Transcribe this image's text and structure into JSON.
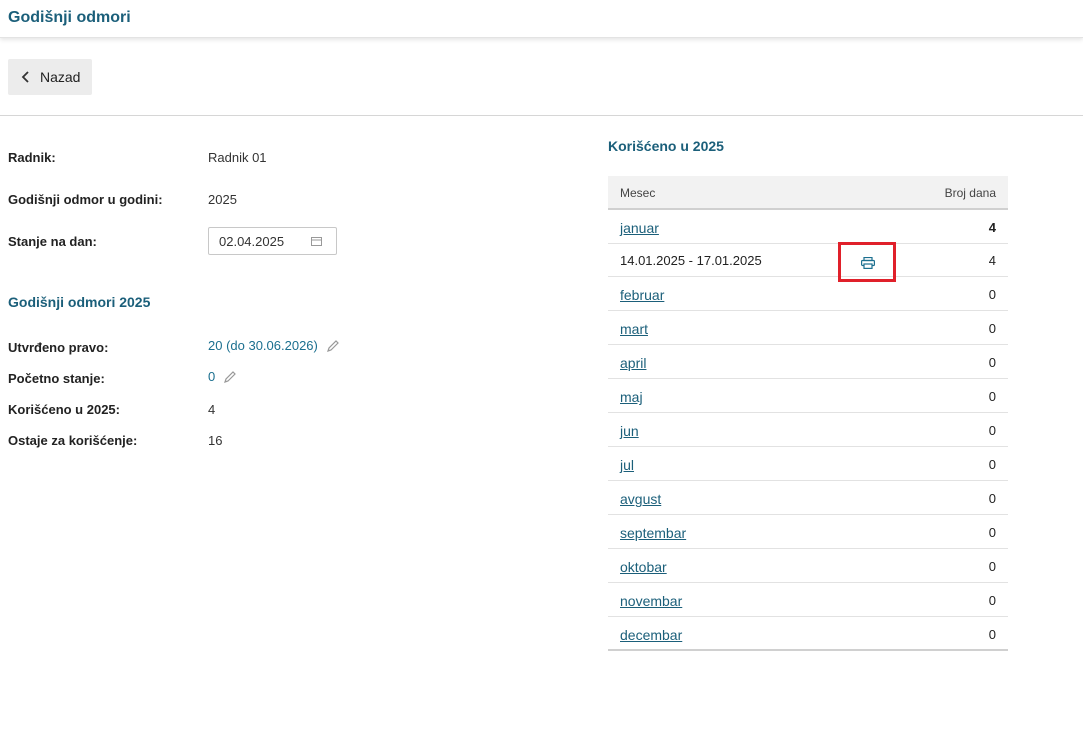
{
  "header": {
    "title": "Godišnji odmori"
  },
  "toolbar": {
    "back_label": "Nazad"
  },
  "form": {
    "employee_label": "Radnik:",
    "employee_value": "Radnik 01",
    "year_label": "Godišnji odmor u godini:",
    "year_value": "2025",
    "date_label": "Stanje na dan:",
    "date_value": "02.04.2025"
  },
  "summary": {
    "title": "Godišnji odmori 2025",
    "entitlement_label": "Utvrđeno pravo:",
    "entitlement_value": "20 (do 30.06.2026)",
    "initial_label": "Početno stanje:",
    "initial_value": "0",
    "used_label": "Korišćeno u 2025:",
    "used_value": "4",
    "remaining_label": "Ostaje za korišćenje:",
    "remaining_value": "16"
  },
  "used_table": {
    "title": "Korišćeno u 2025",
    "col_month": "Mesec",
    "col_days": "Broj dana",
    "rows": [
      {
        "month": "januar",
        "days": "4"
      },
      {
        "month": "februar",
        "days": "0"
      },
      {
        "month": "mart",
        "days": "0"
      },
      {
        "month": "april",
        "days": "0"
      },
      {
        "month": "maj",
        "days": "0"
      },
      {
        "month": "jun",
        "days": "0"
      },
      {
        "month": "jul",
        "days": "0"
      },
      {
        "month": "avgust",
        "days": "0"
      },
      {
        "month": "septembar",
        "days": "0"
      },
      {
        "month": "oktobar",
        "days": "0"
      },
      {
        "month": "novembar",
        "days": "0"
      },
      {
        "month": "decembar",
        "days": "0"
      }
    ],
    "january_period": {
      "range": "14.01.2025 - 17.01.2025",
      "days": "4"
    }
  },
  "colors": {
    "accent": "#1b5f7a",
    "highlight": "#e0202a"
  },
  "icons": {
    "back": "chevron-left-icon",
    "calendar": "calendar-icon",
    "edit": "pencil-icon",
    "print": "printer-icon"
  }
}
